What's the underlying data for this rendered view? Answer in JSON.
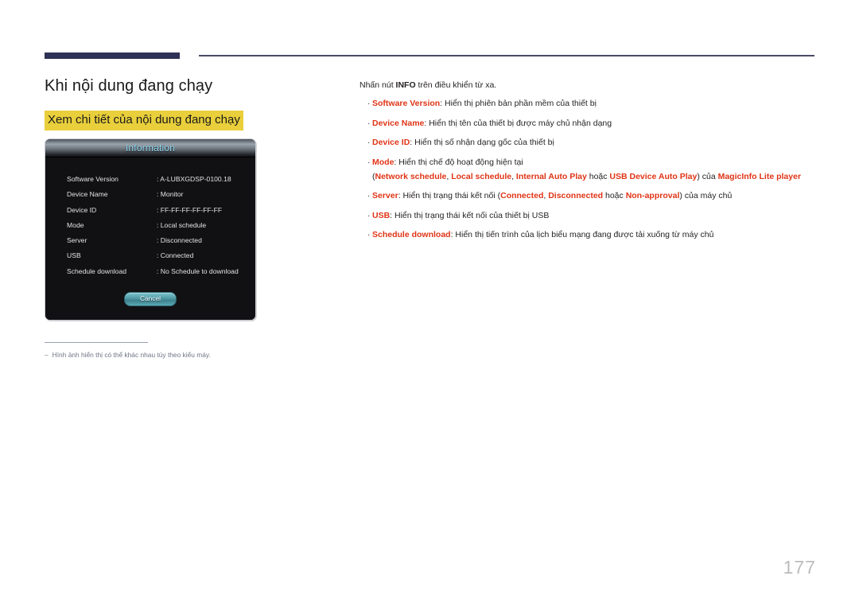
{
  "page": {
    "number": "177",
    "title": "Khi nội dung đang chạy",
    "subtitle": "Xem chi tiết của nội dung đang chạy"
  },
  "dialog": {
    "title": "Information",
    "rows": [
      {
        "label": "Software Version",
        "value": ": A-LUBXGDSP-0100.18"
      },
      {
        "label": "Device Name",
        "value": ": Monitor"
      },
      {
        "label": "Device ID",
        "value": ": FF-FF-FF-FF-FF-FF"
      },
      {
        "label": "Mode",
        "value": ": Local schedule"
      },
      {
        "label": "Server",
        "value": ": Disconnected"
      },
      {
        "label": "USB",
        "value": ": Connected"
      },
      {
        "label": "Schedule download",
        "value": ": No Schedule to download"
      }
    ],
    "cancel_label": "Cancel"
  },
  "footnote": {
    "dash": "–",
    "text": "Hình ảnh hiển thị có thể khác nhau tùy theo kiểu máy."
  },
  "content": {
    "intro_before": "Nhấn nút ",
    "intro_bold": "INFO",
    "intro_after": " trên điều khiển từ xa.",
    "bullet_marker": "·",
    "items": [
      {
        "term": "Software Version",
        "rest": ": Hiển thị phiên bản phần mềm của thiết bị"
      },
      {
        "term": "Device Name",
        "rest": ": Hiển thị tên của thiết bị được máy chủ nhận dạng"
      },
      {
        "term": "Device ID",
        "rest": ": Hiển thị số nhận dạng gốc của thiết bị"
      },
      {
        "term": "Mode",
        "rest": ": Hiển thị chế độ hoạt động hiện tại",
        "sub": {
          "p1": "(",
          "k1": "Network schedule",
          "p2": ", ",
          "k2": "Local schedule",
          "p3": ", ",
          "k3": "Internal Auto Play",
          "p4": " hoặc ",
          "k4": "USB Device Auto Play",
          "p5": ") của ",
          "k5": "MagicInfo Lite player"
        }
      },
      {
        "term": "Server",
        "rest_a": ": Hiển thị trạng thái kết nối (",
        "k1": "Connected",
        "rest_b": ", ",
        "k2": "Disconnected",
        "rest_c": " hoặc ",
        "k3": "Non-approval",
        "rest_d": ") của máy chủ"
      },
      {
        "term": "USB",
        "rest": ": Hiển thị trạng thái kết nối của thiết bị USB"
      },
      {
        "term": "Schedule download",
        "rest": ": Hiển thị tiến trình của lịch biểu mạng đang được tải xuống từ máy chủ"
      }
    ]
  },
  "colors": {
    "accent_red": "#e03416",
    "highlight_yellow": "#e9cf3b",
    "rule_navy": "#2e3255",
    "osd_title_cyan": "#8fd8f2"
  }
}
